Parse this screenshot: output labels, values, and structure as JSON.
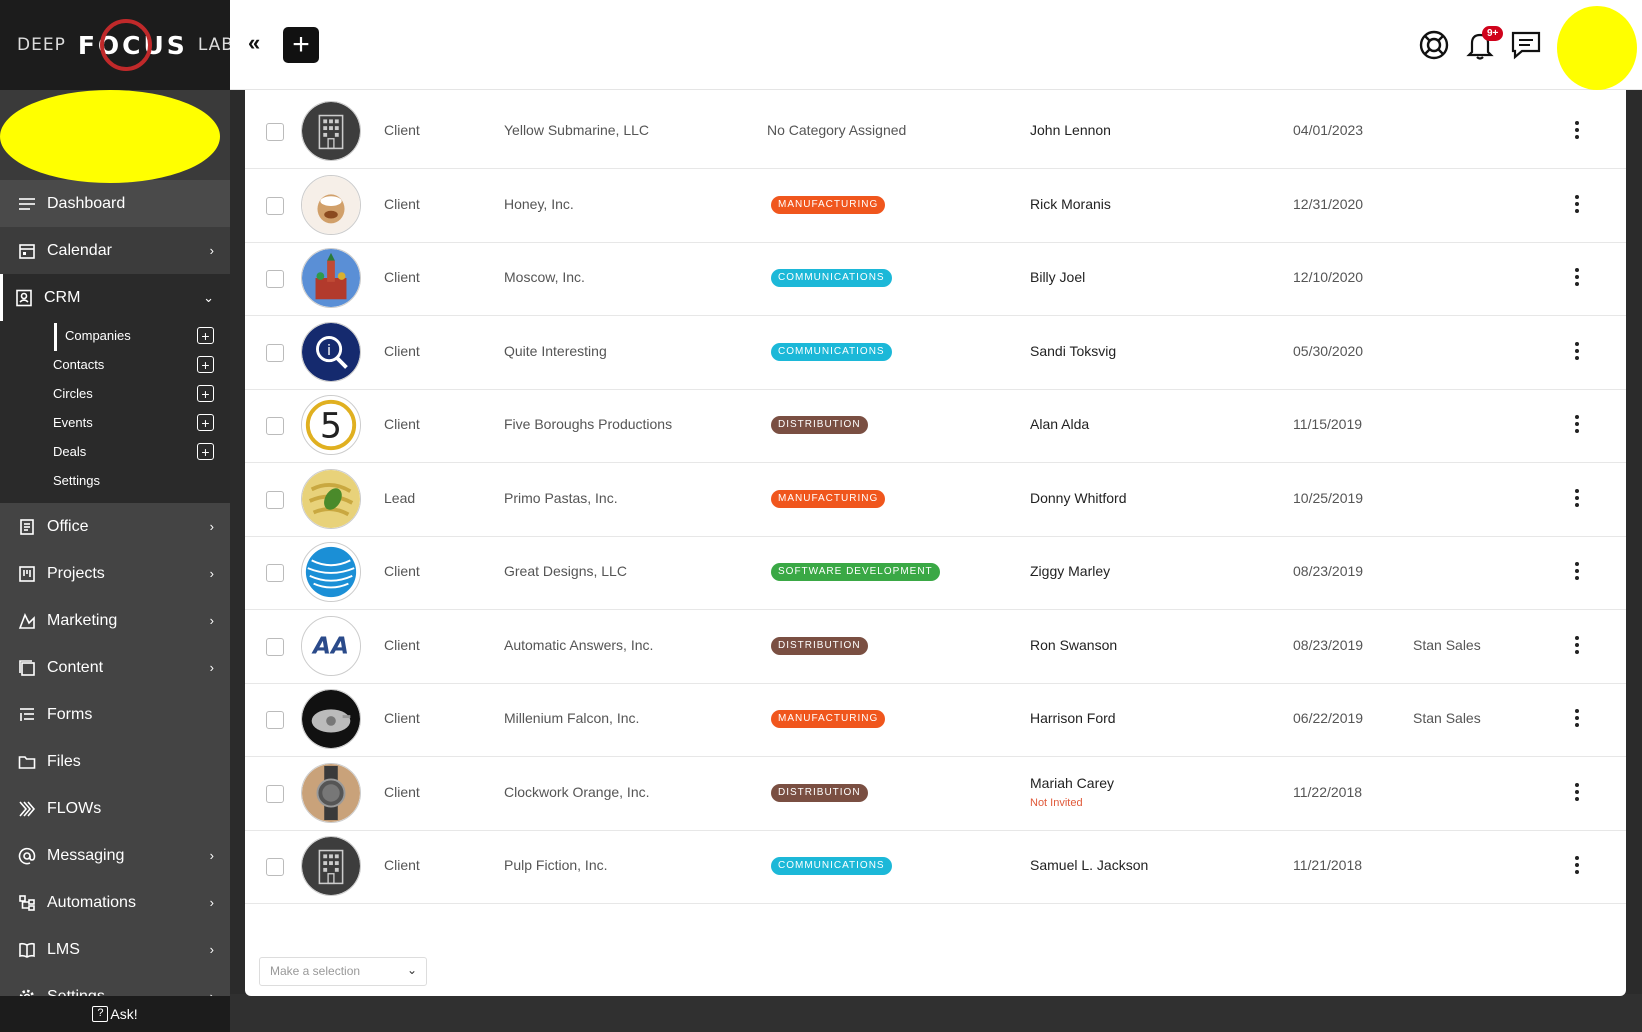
{
  "brand": {
    "left": "DEEP",
    "middle": "FOCUS",
    "right": "LABS"
  },
  "sidebar": {
    "items": [
      {
        "label": "Dashboard",
        "icon": "menu-icon"
      },
      {
        "label": "Calendar",
        "icon": "calendar-icon",
        "chevron": true
      },
      {
        "label": "CRM",
        "icon": "contact-card-icon",
        "expanded": true
      },
      {
        "label": "Office",
        "icon": "office-icon",
        "chevron": true
      },
      {
        "label": "Projects",
        "icon": "kanban-icon",
        "chevron": true
      },
      {
        "label": "Marketing",
        "icon": "marketing-icon",
        "chevron": true
      },
      {
        "label": "Content",
        "icon": "content-icon",
        "chevron": true
      },
      {
        "label": "Forms",
        "icon": "list-icon"
      },
      {
        "label": "Files",
        "icon": "folder-icon"
      },
      {
        "label": "FLOWs",
        "icon": "flow-arrows-icon"
      },
      {
        "label": "Messaging",
        "icon": "at-sign-icon",
        "chevron": true
      },
      {
        "label": "Automations",
        "icon": "automation-icon",
        "chevron": true
      },
      {
        "label": "LMS",
        "icon": "book-icon",
        "chevron": true
      },
      {
        "label": "Settings",
        "icon": "gear-icon",
        "chevron": true
      }
    ],
    "crm_sub": [
      {
        "label": "Companies",
        "active": true,
        "plus": true
      },
      {
        "label": "Contacts",
        "plus": true
      },
      {
        "label": "Circles",
        "plus": true
      },
      {
        "label": "Events",
        "plus": true
      },
      {
        "label": "Deals",
        "plus": true
      },
      {
        "label": "Settings",
        "plus": false
      }
    ],
    "ask_label": "Ask!"
  },
  "topbar": {
    "notification_badge": "9+"
  },
  "colors": {
    "MANUFACTURING": "#f0561d",
    "COMMUNICATIONS": "#1cb8d8",
    "DISTRIBUTION": "#7a4f42",
    "SOFTWARE DEVELOPMENT": "#3aa845"
  },
  "rows": [
    {
      "type": "Client",
      "company": "Yellow Submarine, LLC",
      "category": "No Category Assigned",
      "category_is_badge": false,
      "contact": "John Lennon",
      "date": "04/01/2023",
      "owner": "",
      "logo": "building-logo"
    },
    {
      "type": "Client",
      "company": "Honey, Inc.",
      "category": "MANUFACTURING",
      "category_is_badge": true,
      "contact": "Rick Moranis",
      "date": "12/31/2020",
      "owner": "",
      "logo": "honey-logo"
    },
    {
      "type": "Client",
      "company": "Moscow, Inc.",
      "category": "COMMUNICATIONS",
      "category_is_badge": true,
      "contact": "Billy Joel",
      "date": "12/10/2020",
      "owner": "",
      "logo": "moscow-logo"
    },
    {
      "type": "Client",
      "company": "Quite Interesting",
      "category": "COMMUNICATIONS",
      "category_is_badge": true,
      "contact": "Sandi Toksvig",
      "date": "05/30/2020",
      "owner": "",
      "logo": "qi-logo"
    },
    {
      "type": "Client",
      "company": "Five Boroughs Productions",
      "category": "DISTRIBUTION",
      "category_is_badge": true,
      "contact": "Alan Alda",
      "date": "11/15/2019",
      "owner": "",
      "logo": "five-logo"
    },
    {
      "type": "Lead",
      "company": "Primo Pastas, Inc.",
      "category": "MANUFACTURING",
      "category_is_badge": true,
      "contact": "Donny Whitford",
      "date": "10/25/2019",
      "owner": "",
      "logo": "pasta-logo"
    },
    {
      "type": "Client",
      "company": "Great Designs, LLC",
      "category": "SOFTWARE DEVELOPMENT",
      "category_is_badge": true,
      "contact": "Ziggy Marley",
      "date": "08/23/2019",
      "owner": "",
      "logo": "globe-logo"
    },
    {
      "type": "Client",
      "company": "Automatic Answers, Inc.",
      "category": "DISTRIBUTION",
      "category_is_badge": true,
      "contact": "Ron Swanson",
      "date": "08/23/2019",
      "owner": "Stan Sales",
      "logo": "aa-logo"
    },
    {
      "type": "Client",
      "company": "Millenium Falcon, Inc.",
      "category": "MANUFACTURING",
      "category_is_badge": true,
      "contact": "Harrison Ford",
      "date": "06/22/2019",
      "owner": "Stan Sales",
      "logo": "falcon-logo"
    },
    {
      "type": "Client",
      "company": "Clockwork Orange, Inc.",
      "category": "DISTRIBUTION",
      "category_is_badge": true,
      "contact": "Mariah Carey",
      "contact_note": "Not Invited",
      "date": "11/22/2018",
      "owner": "",
      "logo": "watch-logo"
    },
    {
      "type": "Client",
      "company": "Pulp Fiction, Inc.",
      "category": "COMMUNICATIONS",
      "category_is_badge": true,
      "contact": "Samuel L. Jackson",
      "date": "11/21/2018",
      "owner": "",
      "logo": "building-logo"
    }
  ],
  "bulk_select": {
    "placeholder": "Make a selection"
  }
}
